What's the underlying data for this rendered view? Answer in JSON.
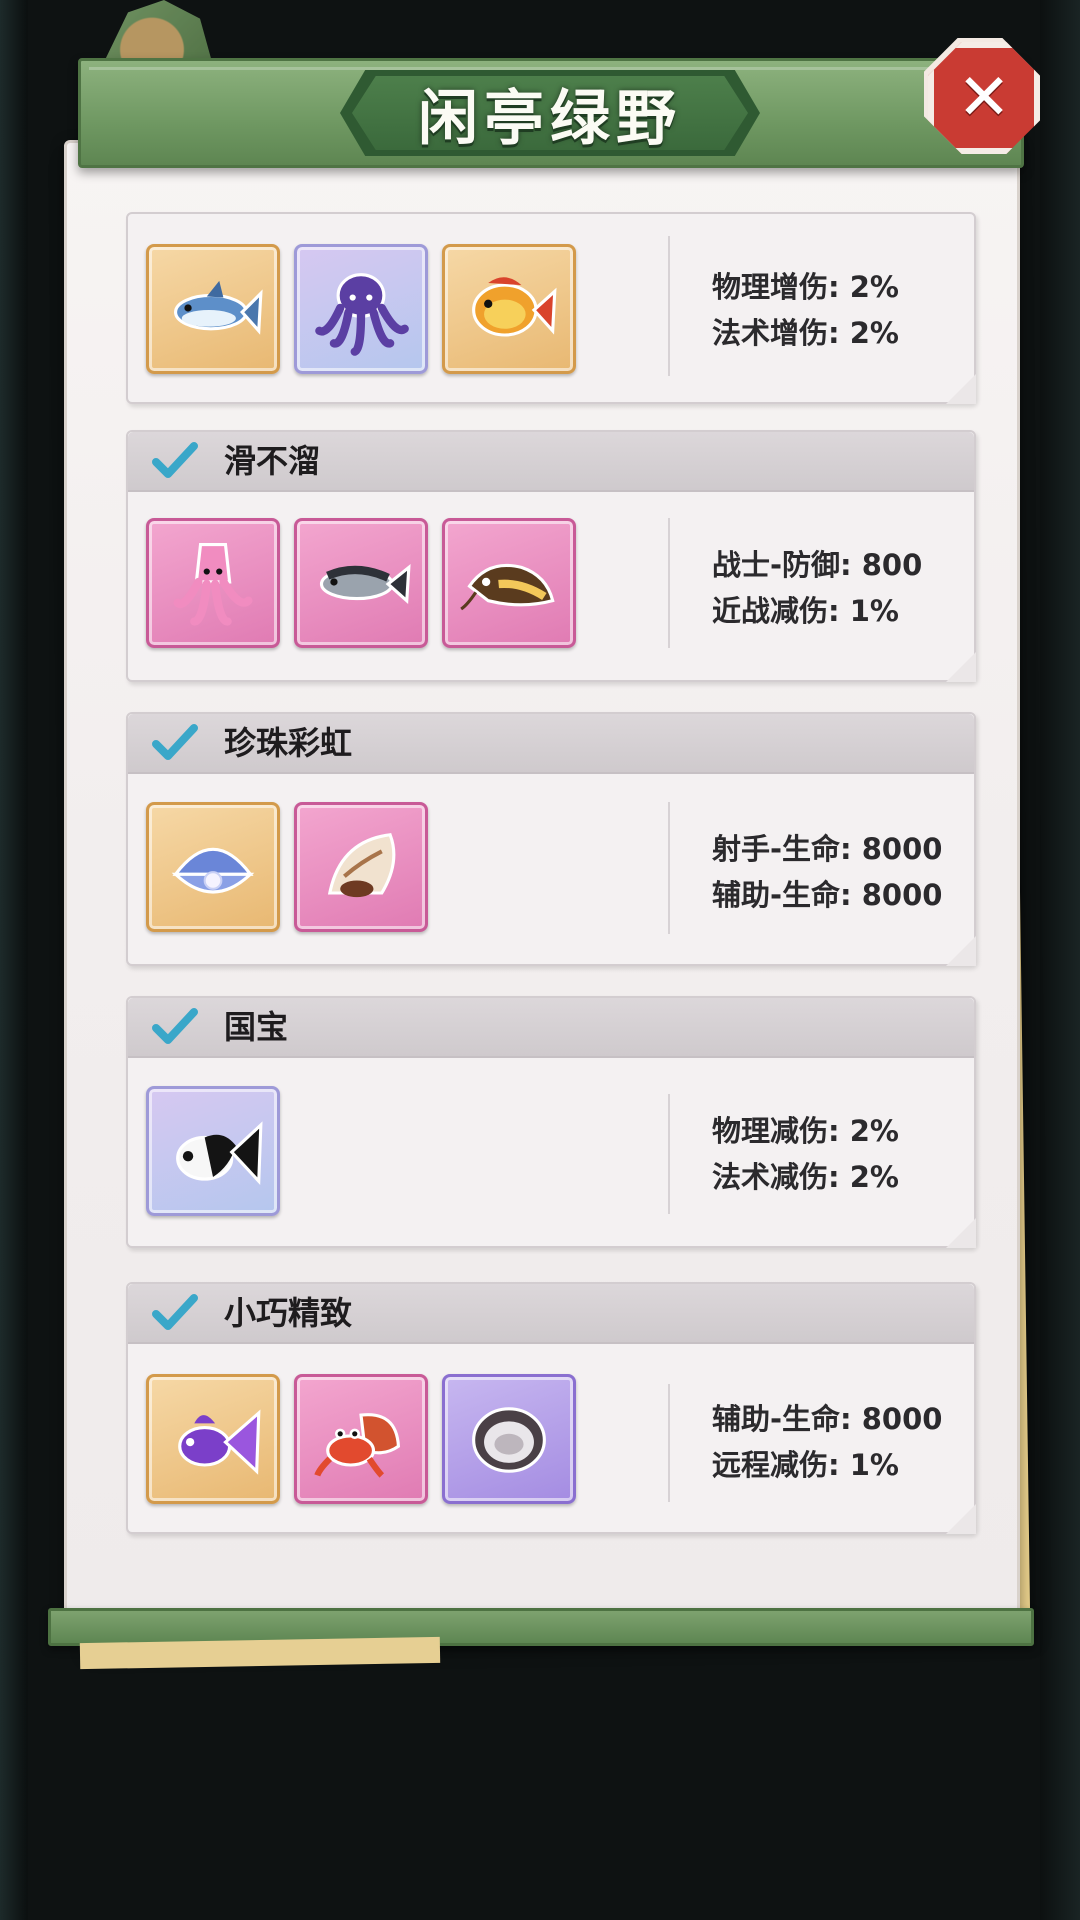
{
  "window": {
    "title": "闲亭绿野"
  },
  "close": {
    "label": "✕"
  },
  "sets": [
    {
      "name": "",
      "checked": false,
      "items": [
        {
          "icon": "tuna-fish-icon",
          "tone": "gold"
        },
        {
          "icon": "octopus-icon",
          "tone": "lilac"
        },
        {
          "icon": "goldfish-icon",
          "tone": "gold"
        }
      ],
      "stats": [
        "物理增伤: 2%",
        "法术增伤: 2%"
      ]
    },
    {
      "name": "滑不溜",
      "checked": true,
      "items": [
        {
          "icon": "squid-icon",
          "tone": "pink"
        },
        {
          "icon": "mackerel-icon",
          "tone": "pink"
        },
        {
          "icon": "catfish-icon",
          "tone": "pink"
        }
      ],
      "stats": [
        "战士-防御: 800",
        "近战减伤: 1%"
      ]
    },
    {
      "name": "珍珠彩虹",
      "checked": true,
      "items": [
        {
          "icon": "pearl-clam-icon",
          "tone": "gold"
        },
        {
          "icon": "conch-shell-icon",
          "tone": "pink"
        }
      ],
      "stats": [
        "射手-生命: 8000",
        "辅助-生命: 8000"
      ]
    },
    {
      "name": "国宝",
      "checked": true,
      "items": [
        {
          "icon": "panda-goldfish-icon",
          "tone": "lilac"
        }
      ],
      "stats": [
        "物理减伤: 2%",
        "法术减伤: 2%"
      ]
    },
    {
      "name": "小巧精致",
      "checked": true,
      "items": [
        {
          "icon": "purple-goldfish-icon",
          "tone": "gold"
        },
        {
          "icon": "hermit-crab-icon",
          "tone": "pink"
        },
        {
          "icon": "oyster-icon",
          "tone": "purple"
        }
      ],
      "stats": [
        "辅助-生命: 8000",
        "远程减伤: 1%"
      ]
    }
  ]
}
